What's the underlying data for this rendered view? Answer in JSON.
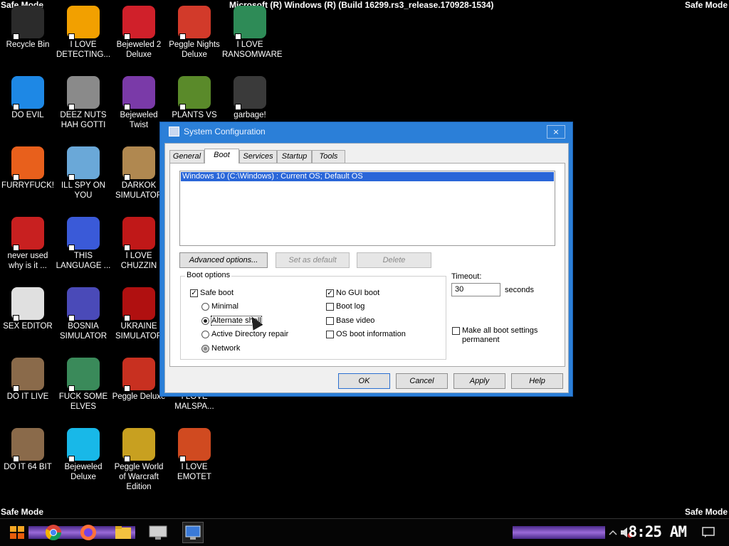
{
  "desktop": {
    "safe_mode_label": "Safe Mode",
    "build_string": "Microsoft (R) Windows (R) (Build 16299.rs3_release.170928-1534)",
    "icons": [
      {
        "label": "Recycle Bin",
        "icon": "recycle-bin-icon",
        "color": "#2b2b2b"
      },
      {
        "label": "I LOVE DETECTING...",
        "icon": "detect-it-easy-icon",
        "color": "#f2a000"
      },
      {
        "label": "Bejeweled 2 Deluxe",
        "icon": "bejeweled-2-icon",
        "color": "#d0202a"
      },
      {
        "label": "Peggle Nights Deluxe",
        "icon": "peggle-nights-icon",
        "color": "#d23a2a"
      },
      {
        "label": "I LOVE RANSOMWARE",
        "icon": "project-icon",
        "color": "#2e8b57"
      },
      {
        "label": "DO EVIL",
        "icon": "chrome-icon",
        "color": "#1e88e5"
      },
      {
        "label": "DEEZ NUTS HAH GOTTI",
        "icon": "copy-icon",
        "color": "#8a8a8a"
      },
      {
        "label": "Bejeweled Twist",
        "icon": "bejeweled-twist-icon",
        "color": "#7a3aa8"
      },
      {
        "label": "PLANTS VS",
        "icon": "plants-vs-zombies-icon",
        "color": "#5a8a2a"
      },
      {
        "label": "garbage!",
        "icon": "garbage-icon",
        "color": "#3a3a3a"
      },
      {
        "label": "FURRYFUCK!",
        "icon": "firefox-icon",
        "color": "#e8601c"
      },
      {
        "label": "ILL SPY ON YOU",
        "icon": "network-icon",
        "color": "#6aa8d8"
      },
      {
        "label": "DARKOK SIMULATOR",
        "icon": "money-bag-icon",
        "color": "#b08850"
      },
      {
        "label": "never used why is it ...",
        "icon": "dev-cpp-icon",
        "color": "#c82020"
      },
      {
        "label": "THIS LANGUAGE ...",
        "icon": "goland-icon",
        "color": "#3a5ad8"
      },
      {
        "label": "I LOVE CHUZZIN",
        "icon": "chuzzle-icon",
        "color": "#c01818"
      },
      {
        "label": "SEX EDITOR",
        "icon": "hxd-icon",
        "color": "#e0e0e0"
      },
      {
        "label": "BOSNIA SIMULATOR",
        "icon": "mine-icon",
        "color": "#4a4ab8"
      },
      {
        "label": "UKRAINE SIMULATOR",
        "icon": "radiation-icon",
        "color": "#b01010"
      },
      {
        "label": "DO IT LIVE",
        "icon": "portrait-icon",
        "color": "#8a6a4a"
      },
      {
        "label": "FUCK SOME ELVES",
        "icon": "elf-icon",
        "color": "#3a8a5a"
      },
      {
        "label": "Peggle Deluxe",
        "icon": "peggle-icon",
        "color": "#c83020"
      },
      {
        "label": "I LOVE MALSPA...",
        "icon": "malware-icon",
        "color": "#2a2a2a"
      },
      {
        "label": "DO IT 64 BIT",
        "icon": "portrait-64-icon",
        "color": "#8a6a4a"
      },
      {
        "label": "Bejeweled Deluxe",
        "icon": "diamond-icon",
        "color": "#18b8e8"
      },
      {
        "label": "Peggle World of Warcraft Edition",
        "icon": "peggle-wow-icon",
        "color": "#c8a020"
      },
      {
        "label": "I LOVE EMOTET",
        "icon": "powerpoint-icon",
        "color": "#d04a20"
      }
    ]
  },
  "dialog": {
    "title": "System Configuration",
    "close": "×",
    "tabs": [
      "General",
      "Boot",
      "Services",
      "Startup",
      "Tools"
    ],
    "os_entry": "Windows 10 (C:\\Windows) : Current OS; Default OS",
    "buttons": {
      "advanced": "Advanced options...",
      "set_default": "Set as default",
      "delete": "Delete",
      "ok": "OK",
      "cancel": "Cancel",
      "apply": "Apply",
      "help": "Help"
    },
    "boot_options": {
      "legend": "Boot options",
      "safe_boot": "Safe boot",
      "minimal": "Minimal",
      "alternate_shell": "Alternate shell",
      "ad_repair": "Active Directory repair",
      "network": "Network",
      "no_gui": "No GUI boot",
      "boot_log": "Boot log",
      "base_video": "Base video",
      "os_boot_info": "OS boot information"
    },
    "timeout_label": "Timeout:",
    "timeout_value": "30",
    "seconds": "seconds",
    "make_permanent": "Make all boot settings",
    "make_permanent2": "permanent"
  },
  "taskbar": {
    "clock": "8:25 AM"
  }
}
